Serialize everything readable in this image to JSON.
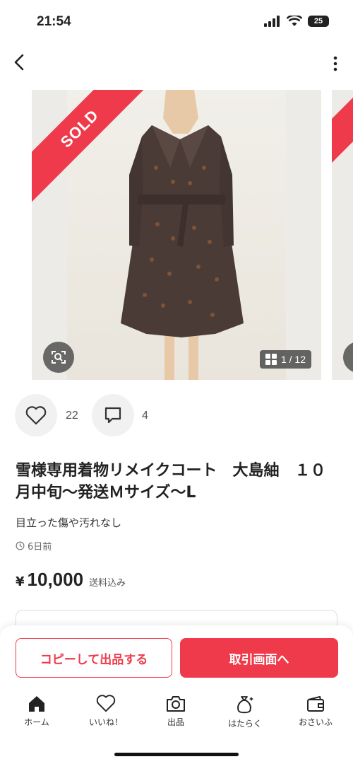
{
  "status_bar": {
    "time": "21:54",
    "battery": "25"
  },
  "product": {
    "sold_label": "SOLD",
    "image_counter": "1 / 12",
    "likes": "22",
    "comments": "4",
    "title": "雪様専用着物リメイクコート　大島紬　１０月中旬〜発送Ｍサイズ〜L",
    "condition": "目立った傷や汚れなし",
    "posted": "6日前",
    "price_symbol": "¥",
    "price": "10,000",
    "shipping": "送料込み"
  },
  "actions": {
    "copy_label": "コピーして出品する",
    "trade_label": "取引画面へ"
  },
  "tabs": [
    {
      "label": "ホーム",
      "icon": "home-icon"
    },
    {
      "label": "いいね！",
      "icon": "heart-icon"
    },
    {
      "label": "出品",
      "icon": "camera-icon"
    },
    {
      "label": "はたらく",
      "icon": "money-bag-icon"
    },
    {
      "label": "おさいふ",
      "icon": "wallet-icon"
    }
  ],
  "colors": {
    "accent": "#ee3a4a"
  }
}
